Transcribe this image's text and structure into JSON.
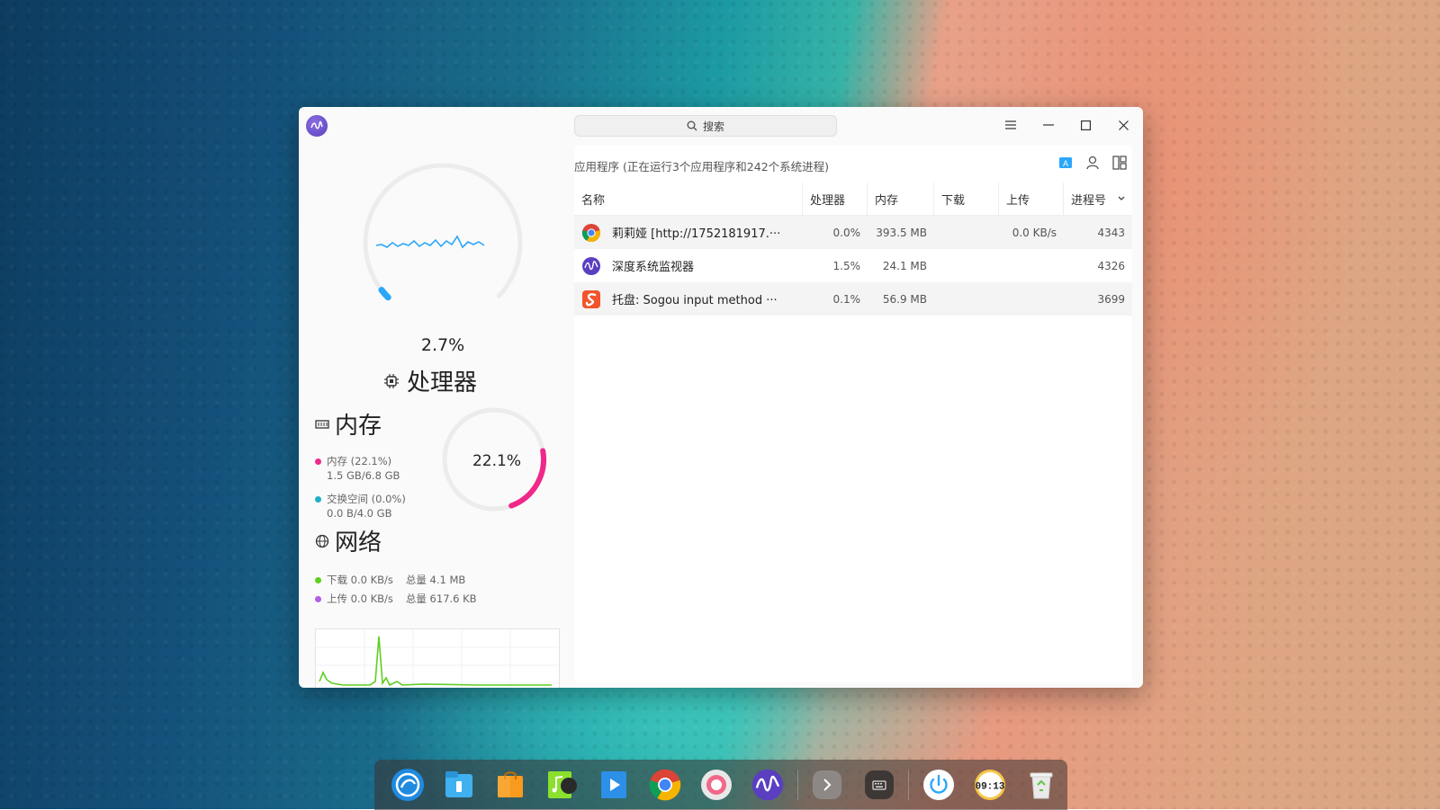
{
  "window": {
    "search_placeholder": "搜索",
    "controls": [
      "menu",
      "minimize",
      "maximize",
      "close"
    ]
  },
  "cpu": {
    "percent_label": "2.7%",
    "percent": 2.7,
    "title": "处理器"
  },
  "memory": {
    "title": "内存",
    "percent_label": "22.1%",
    "percent": 22.1,
    "mem_label": "内存 (22.1%)",
    "mem_value": "1.5 GB/6.8 GB",
    "swap_label": "交换空间 (0.0%)",
    "swap_value": "0.0 B/4.0 GB"
  },
  "network": {
    "title": "网络",
    "download": "下载 0.0 KB/s",
    "download_total": "总量 4.1 MB",
    "upload": "上传 0.0 KB/s",
    "upload_total": "总量 617.6 KB"
  },
  "processes": {
    "section_label": "应用程序 (正在运行3个应用程序和242个系统进程)",
    "columns": [
      "名称",
      "处理器",
      "内存",
      "下载",
      "上传",
      "进程号"
    ],
    "rows": [
      {
        "name": "莉莉娅 [http://1752181917.···",
        "cpu": "0.0%",
        "mem": "393.5 MB",
        "download": "",
        "upload": "0.0 KB/s",
        "pid": "4343",
        "icon": "chrome-icon"
      },
      {
        "name": "深度系统监视器",
        "cpu": "1.5%",
        "mem": "24.1 MB",
        "download": "",
        "upload": "",
        "pid": "4326",
        "icon": "system-monitor-icon"
      },
      {
        "name": "托盘: Sogou input method ···",
        "cpu": "0.1%",
        "mem": "56.9 MB",
        "download": "",
        "upload": "",
        "pid": "3699",
        "icon": "sogou-icon"
      }
    ]
  },
  "colors": {
    "cpu": "#2ca7f8",
    "memory": "#f0288a",
    "swap": "#1cb0c6",
    "download": "#5fcf1f",
    "upload": "#b45de6"
  },
  "dock": {
    "items": [
      "launcher-icon",
      "file-manager-icon",
      "app-store-icon",
      "music-icon",
      "video-icon",
      "chrome-icon",
      "settings-icon",
      "system-monitor-icon",
      "expand-icon",
      "keyboard-icon",
      "power-icon",
      "clock-icon",
      "trash-icon"
    ],
    "clock_text": "09:13"
  }
}
